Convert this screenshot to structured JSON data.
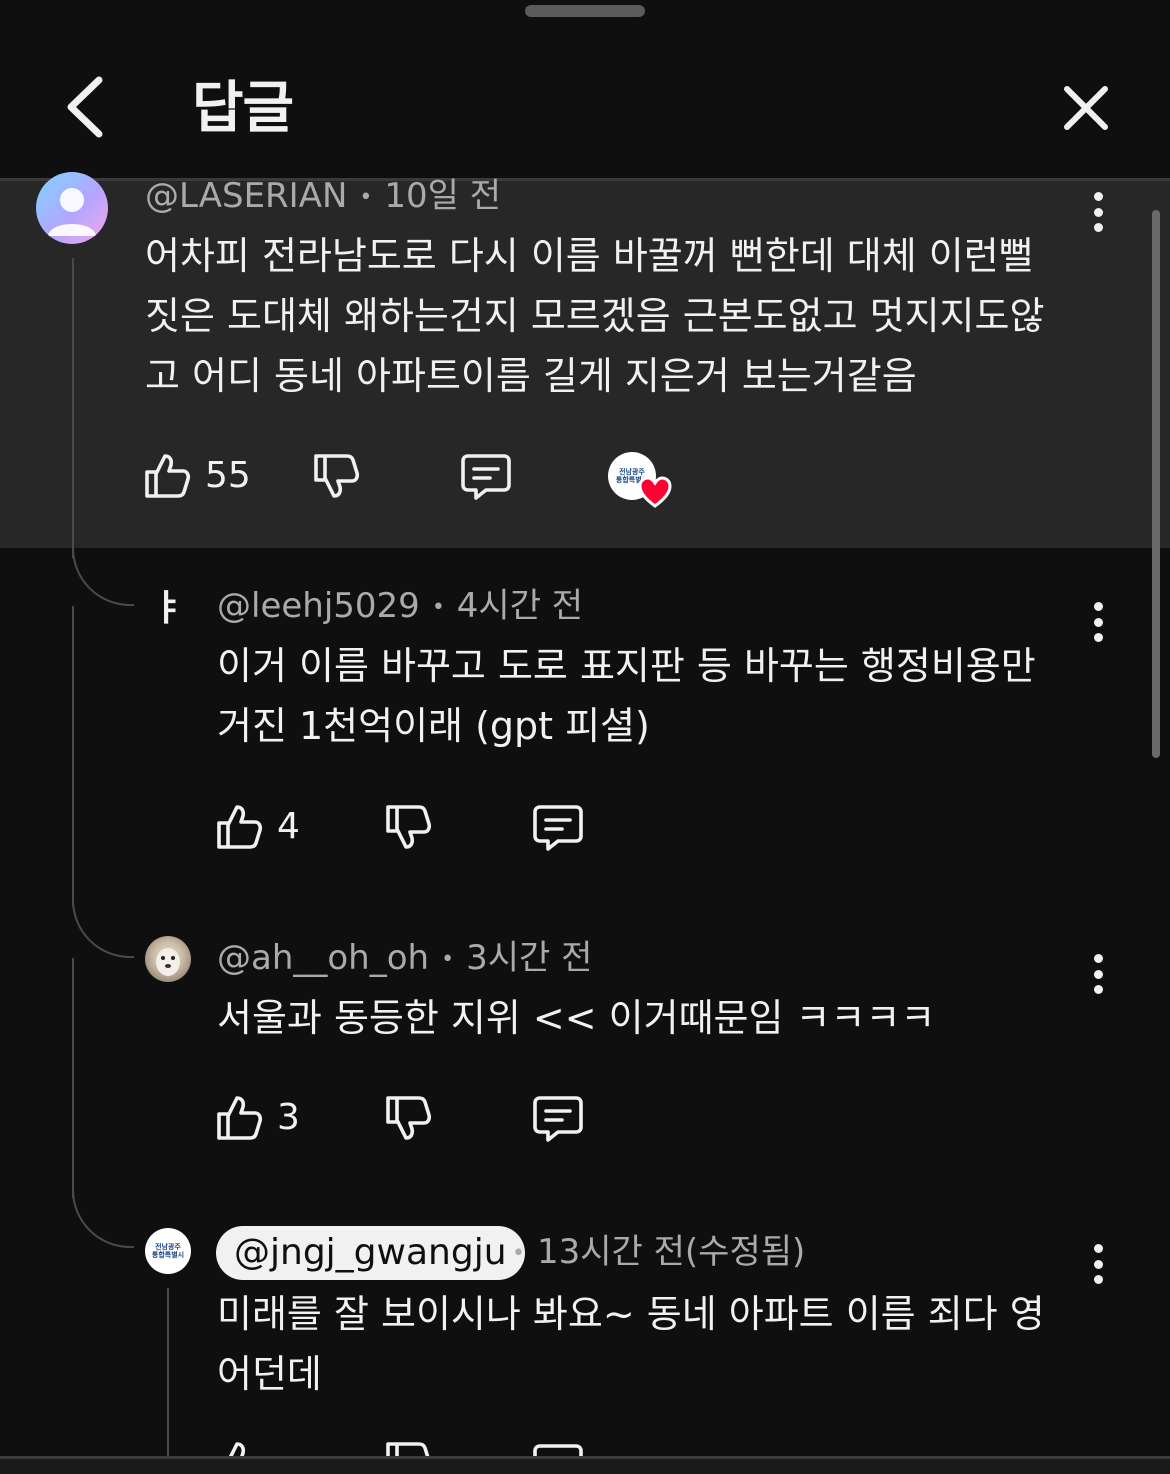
{
  "header": {
    "title": "답글",
    "back_icon": "chevron-left-icon",
    "close_icon": "close-icon"
  },
  "parent": {
    "author": "@LASERIAN",
    "time": "10일 전",
    "lines": [
      "어차피 전라남도로 다시 이름 바꿀꺼 뻔한데 대체 이런뻘",
      "짓은 도대체 왜하는건지 모르겠음 근본도없고 멋지지도않",
      "고 어디 동네 아파트이름 길게 지은거 보는거같음"
    ],
    "likes": "55",
    "creator_heart_label": "전남광주 통합특별시"
  },
  "replies": [
    {
      "author": "@leehj5029",
      "time": "4시간 전",
      "avatar_text": "ㅑ",
      "lines": [
        "이거 이름 바꾸고 도로 표지판 등 바꾸는 행정비용만",
        "거진 1천억이래 (gpt 피셜)"
      ],
      "likes": "4"
    },
    {
      "author": "@ah__oh_oh",
      "time": "3시간 전",
      "lines": [
        "서울과 동등한 지위 << 이거때문임 ㅋㅋㅋㅋ"
      ],
      "likes": "3"
    },
    {
      "author": "@jngj_gwangju",
      "time": "13시간 전(수정됨)",
      "avatar_text": "전남광주 통합특별시",
      "lines": [
        "미래를 잘 보이시나 봐요~ 동네 아파트 이름 죄다 영",
        "어던데"
      ]
    }
  ],
  "colors": {
    "background": "#0f0f0f",
    "parent_background": "#272727",
    "text": "#f1f1f1",
    "meta_text": "#aaaaaa",
    "heart": "#ff0033"
  }
}
